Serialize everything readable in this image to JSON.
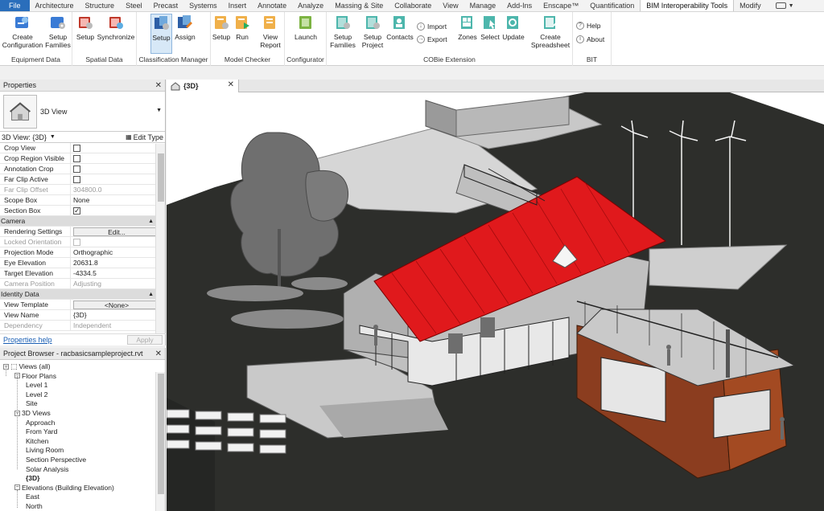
{
  "ribbon_tabs": [
    "File",
    "Architecture",
    "Structure",
    "Steel",
    "Precast",
    "Systems",
    "Insert",
    "Annotate",
    "Analyze",
    "Massing & Site",
    "Collaborate",
    "View",
    "Manage",
    "Add-Ins",
    "Enscape™",
    "Quantification",
    "BIM Interoperability Tools",
    "Modify"
  ],
  "active_tab": "BIM Interoperability Tools",
  "groups": {
    "equipment": {
      "title": "Equipment Data",
      "create": "Create\nConfiguration",
      "setup_families": "Setup\nFamilies"
    },
    "spatial": {
      "title": "Spatial Data",
      "setup": "Setup",
      "synchronize": "Synchronize"
    },
    "classification": {
      "title": "Classification Manager",
      "setup": "Setup",
      "assign": "Assign"
    },
    "model_checker": {
      "title": "Model Checker",
      "setup": "Setup",
      "run": "Run",
      "view_report": "View\nReport"
    },
    "configurator": {
      "title": "Configurator",
      "launch": "Launch"
    },
    "cobie": {
      "title": "COBie Extension",
      "setup_families": "Setup\nFamilies",
      "setup_project": "Setup\nProject",
      "contacts": "Contacts",
      "import": "Import",
      "export": "Export",
      "zones": "Zones",
      "select": "Select",
      "update": "Update",
      "create_spreadsheet": "Create\nSpreadsheet"
    },
    "bit": {
      "title": "BIT",
      "help": "Help",
      "about": "About"
    }
  },
  "properties": {
    "title": "Properties",
    "type_name": "3D View",
    "instance": "3D View: {3D}",
    "edit_type": "Edit Type",
    "rows": [
      {
        "k": "Crop View",
        "check": false
      },
      {
        "k": "Crop Region Visible",
        "check": false
      },
      {
        "k": "Annotation Crop",
        "check": false
      },
      {
        "k": "Far Clip Active",
        "check": false
      },
      {
        "k": "Far Clip Offset",
        "v": "304800.0",
        "dim": true
      },
      {
        "k": "Scope Box",
        "v": "None"
      },
      {
        "k": "Section Box",
        "check": true
      }
    ],
    "camera_section": "Camera",
    "camera_rows": [
      {
        "k": "Rendering Settings",
        "button": "Edit..."
      },
      {
        "k": "Locked Orientation",
        "check": false,
        "dim": true
      },
      {
        "k": "Projection Mode",
        "v": "Orthographic"
      },
      {
        "k": "Eye Elevation",
        "v": "20631.8"
      },
      {
        "k": "Target Elevation",
        "v": "-4334.5"
      },
      {
        "k": "Camera Position",
        "v": "Adjusting",
        "dim": true
      }
    ],
    "identity_section": "Identity Data",
    "identity_rows": [
      {
        "k": "View Template",
        "button": "<None>"
      },
      {
        "k": "View Name",
        "v": "{3D}"
      },
      {
        "k": "Dependency",
        "v": "Independent",
        "dim": true
      }
    ],
    "help_link": "Properties help",
    "apply": "Apply"
  },
  "browser": {
    "title": "Project Browser - racbasicsampleproject.rvt",
    "nodes": [
      {
        "label": "Views (all)",
        "level": 0,
        "exp": true
      },
      {
        "label": "Floor Plans",
        "level": 1,
        "exp": true
      },
      {
        "label": "Level 1",
        "level": 2
      },
      {
        "label": "Level 2",
        "level": 2
      },
      {
        "label": "Site",
        "level": 2
      },
      {
        "label": "3D Views",
        "level": 1,
        "exp": true
      },
      {
        "label": "Approach",
        "level": 2
      },
      {
        "label": "From Yard",
        "level": 2
      },
      {
        "label": "Kitchen",
        "level": 2
      },
      {
        "label": "Living Room",
        "level": 2
      },
      {
        "label": "Section Perspective",
        "level": 2
      },
      {
        "label": "Solar Analysis",
        "level": 2
      },
      {
        "label": "{3D}",
        "level": 2,
        "bold": true
      },
      {
        "label": "Elevations (Building Elevation)",
        "level": 1,
        "exp": true
      },
      {
        "label": "East",
        "level": 2
      },
      {
        "label": "North",
        "level": 2
      }
    ]
  },
  "view_tab": "{3D}"
}
